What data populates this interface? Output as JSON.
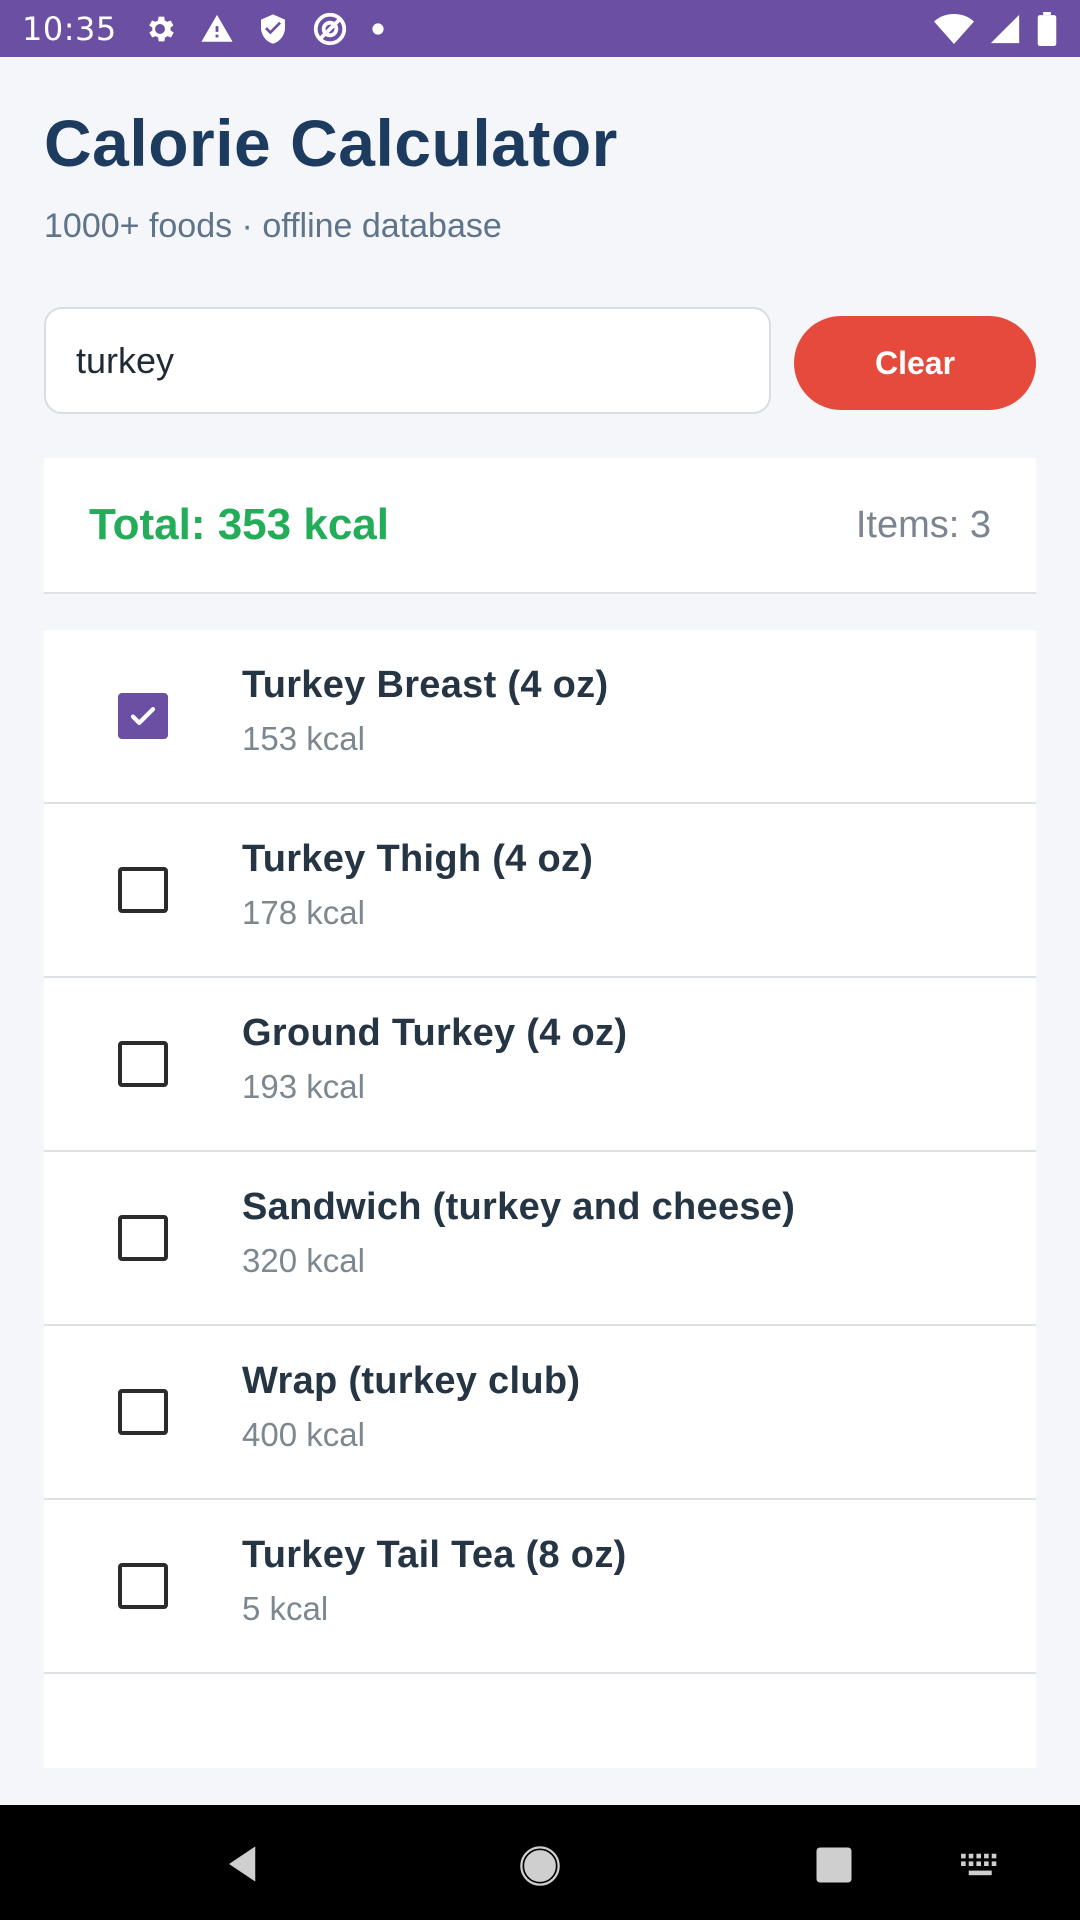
{
  "status_bar": {
    "time": "10:35",
    "left_icons": [
      "settings-icon",
      "warning-icon",
      "shield-icon",
      "no-location-icon",
      "dot-icon"
    ],
    "right_icons": [
      "wifi-icon",
      "signal-icon",
      "battery-icon"
    ],
    "background_color": "#6a4fa3"
  },
  "header": {
    "title": "Calorie Calculator",
    "subtitle": "1000+ foods · offline database"
  },
  "search": {
    "value": "turkey",
    "placeholder": ""
  },
  "clear_button": {
    "label": "Clear",
    "color": "#e64a3c"
  },
  "totals": {
    "total_label": "Total: 353 kcal",
    "items_label": "Items: 3",
    "total_color": "#23ad58"
  },
  "foods": [
    {
      "name": "Turkey Breast (4 oz)",
      "kcal": "153 kcal",
      "checked": true
    },
    {
      "name": "Turkey Thigh (4 oz)",
      "kcal": "178 kcal",
      "checked": false
    },
    {
      "name": "Ground Turkey (4 oz)",
      "kcal": "193 kcal",
      "checked": false
    },
    {
      "name": "Sandwich (turkey and cheese)",
      "kcal": "320 kcal",
      "checked": false
    },
    {
      "name": "Wrap (turkey club)",
      "kcal": "400 kcal",
      "checked": false
    },
    {
      "name": "Turkey Tail Tea (8 oz)",
      "kcal": "5 kcal",
      "checked": false
    }
  ],
  "nav_bar": {
    "buttons": [
      "back-icon",
      "home-icon",
      "recents-icon",
      "keyboard-icon"
    ]
  },
  "accent_color": "#6a4fa3"
}
